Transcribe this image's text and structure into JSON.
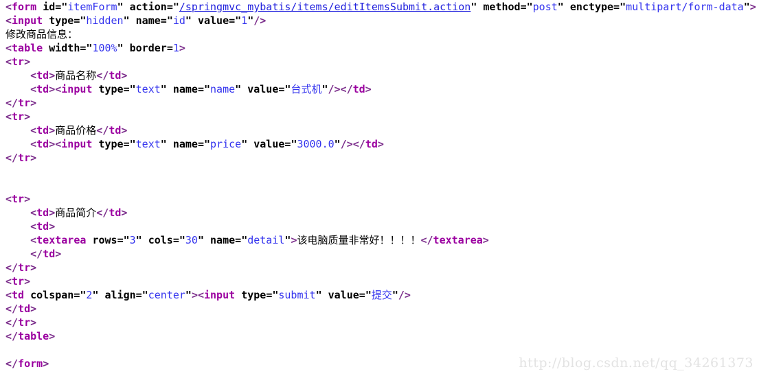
{
  "document": {
    "kind": "html-code-snippet",
    "background_color": "#ffffff",
    "syntax_colors": {
      "tag": "#9b00a0",
      "bracket": "#7b2d8b",
      "attribute": "#000000",
      "value": "#3333ee",
      "link": "#2222dd",
      "text": "#000000",
      "watermark": "#e3e3e3"
    }
  },
  "code": {
    "lines": [
      {
        "id": "line-form-open",
        "indent": 0,
        "tokens": [
          {
            "t": "bracket",
            "v": "<"
          },
          {
            "t": "tag",
            "v": "form"
          },
          {
            "t": "plain",
            "v": " "
          },
          {
            "t": "attr",
            "v": "id"
          },
          {
            "t": "eq",
            "v": "="
          },
          {
            "t": "quote",
            "v": "\""
          },
          {
            "t": "value",
            "v": "itemForm"
          },
          {
            "t": "quote",
            "v": "\""
          },
          {
            "t": "plain",
            "v": " "
          },
          {
            "t": "attr",
            "v": "action"
          },
          {
            "t": "eq",
            "v": "="
          },
          {
            "t": "quote",
            "v": "\""
          },
          {
            "t": "link",
            "v": "/springmvc_mybatis/items/editItemsSubmit.action"
          },
          {
            "t": "quote",
            "v": "\""
          },
          {
            "t": "plain",
            "v": " "
          },
          {
            "t": "attr",
            "v": "method"
          },
          {
            "t": "eq",
            "v": "="
          },
          {
            "t": "quote",
            "v": "\""
          },
          {
            "t": "value",
            "v": "post"
          },
          {
            "t": "quote",
            "v": "\""
          },
          {
            "t": "plain",
            "v": " "
          },
          {
            "t": "attr",
            "v": "enctype"
          },
          {
            "t": "eq",
            "v": "="
          },
          {
            "t": "quote",
            "v": "\""
          },
          {
            "t": "value",
            "v": "multipart/form-data"
          },
          {
            "t": "quote",
            "v": "\""
          },
          {
            "t": "bracket",
            "v": ">"
          }
        ]
      },
      {
        "id": "line-input-hidden",
        "indent": 0,
        "tokens": [
          {
            "t": "bracket",
            "v": "<"
          },
          {
            "t": "tag",
            "v": "input"
          },
          {
            "t": "plain",
            "v": " "
          },
          {
            "t": "attr",
            "v": "type"
          },
          {
            "t": "eq",
            "v": "="
          },
          {
            "t": "quote",
            "v": "\""
          },
          {
            "t": "value",
            "v": "hidden"
          },
          {
            "t": "quote",
            "v": "\""
          },
          {
            "t": "plain",
            "v": " "
          },
          {
            "t": "attr",
            "v": "name"
          },
          {
            "t": "eq",
            "v": "="
          },
          {
            "t": "quote",
            "v": "\""
          },
          {
            "t": "value",
            "v": "id"
          },
          {
            "t": "quote",
            "v": "\""
          },
          {
            "t": "plain",
            "v": " "
          },
          {
            "t": "attr",
            "v": "value"
          },
          {
            "t": "eq",
            "v": "="
          },
          {
            "t": "quote",
            "v": "\""
          },
          {
            "t": "value",
            "v": "1"
          },
          {
            "t": "quote",
            "v": "\""
          },
          {
            "t": "bracket",
            "v": "/>"
          }
        ]
      },
      {
        "id": "line-title-text",
        "indent": 0,
        "tokens": [
          {
            "t": "cjk",
            "v": "修改商品信息："
          }
        ]
      },
      {
        "id": "line-table-open",
        "indent": 0,
        "tokens": [
          {
            "t": "bracket",
            "v": "<"
          },
          {
            "t": "tag",
            "v": "table"
          },
          {
            "t": "plain",
            "v": " "
          },
          {
            "t": "attr",
            "v": "width"
          },
          {
            "t": "eq",
            "v": "="
          },
          {
            "t": "quote",
            "v": "\""
          },
          {
            "t": "value",
            "v": "100%"
          },
          {
            "t": "quote",
            "v": "\""
          },
          {
            "t": "plain",
            "v": " "
          },
          {
            "t": "attr",
            "v": "border"
          },
          {
            "t": "eq",
            "v": "="
          },
          {
            "t": "value",
            "v": "1"
          },
          {
            "t": "bracket",
            "v": ">"
          }
        ]
      },
      {
        "id": "line-tr-open-1",
        "indent": 0,
        "tokens": [
          {
            "t": "bracket",
            "v": "<"
          },
          {
            "t": "tag",
            "v": "tr"
          },
          {
            "t": "bracket",
            "v": ">"
          }
        ]
      },
      {
        "id": "line-td-name-label",
        "indent": 4,
        "tokens": [
          {
            "t": "bracket",
            "v": "<"
          },
          {
            "t": "tag",
            "v": "td"
          },
          {
            "t": "bracket",
            "v": ">"
          },
          {
            "t": "cjk",
            "v": "商品名称"
          },
          {
            "t": "bracket",
            "v": "</"
          },
          {
            "t": "tag",
            "v": "td"
          },
          {
            "t": "bracket",
            "v": ">"
          }
        ]
      },
      {
        "id": "line-td-name-input",
        "indent": 4,
        "tokens": [
          {
            "t": "bracket",
            "v": "<"
          },
          {
            "t": "tag",
            "v": "td"
          },
          {
            "t": "bracket",
            "v": "><"
          },
          {
            "t": "tag",
            "v": "input"
          },
          {
            "t": "plain",
            "v": " "
          },
          {
            "t": "attr",
            "v": "type"
          },
          {
            "t": "eq",
            "v": "="
          },
          {
            "t": "quote",
            "v": "\""
          },
          {
            "t": "value",
            "v": "text"
          },
          {
            "t": "quote",
            "v": "\""
          },
          {
            "t": "plain",
            "v": " "
          },
          {
            "t": "attr",
            "v": "name"
          },
          {
            "t": "eq",
            "v": "="
          },
          {
            "t": "quote",
            "v": "\""
          },
          {
            "t": "value",
            "v": "name"
          },
          {
            "t": "quote",
            "v": "\""
          },
          {
            "t": "plain",
            "v": " "
          },
          {
            "t": "attr",
            "v": "value"
          },
          {
            "t": "eq",
            "v": "="
          },
          {
            "t": "quote",
            "v": "\""
          },
          {
            "t": "value-cjk",
            "v": "台式机"
          },
          {
            "t": "quote",
            "v": "\""
          },
          {
            "t": "bracket",
            "v": "/></"
          },
          {
            "t": "tag",
            "v": "td"
          },
          {
            "t": "bracket",
            "v": ">"
          }
        ]
      },
      {
        "id": "line-tr-close-1",
        "indent": 0,
        "tokens": [
          {
            "t": "bracket",
            "v": "</"
          },
          {
            "t": "tag",
            "v": "tr"
          },
          {
            "t": "bracket",
            "v": ">"
          }
        ]
      },
      {
        "id": "line-tr-open-2",
        "indent": 0,
        "tokens": [
          {
            "t": "bracket",
            "v": "<"
          },
          {
            "t": "tag",
            "v": "tr"
          },
          {
            "t": "bracket",
            "v": ">"
          }
        ]
      },
      {
        "id": "line-td-price-label",
        "indent": 4,
        "tokens": [
          {
            "t": "bracket",
            "v": "<"
          },
          {
            "t": "tag",
            "v": "td"
          },
          {
            "t": "bracket",
            "v": ">"
          },
          {
            "t": "cjk",
            "v": "商品价格"
          },
          {
            "t": "bracket",
            "v": "</"
          },
          {
            "t": "tag",
            "v": "td"
          },
          {
            "t": "bracket",
            "v": ">"
          }
        ]
      },
      {
        "id": "line-td-price-input",
        "indent": 4,
        "tokens": [
          {
            "t": "bracket",
            "v": "<"
          },
          {
            "t": "tag",
            "v": "td"
          },
          {
            "t": "bracket",
            "v": "><"
          },
          {
            "t": "tag",
            "v": "input"
          },
          {
            "t": "plain",
            "v": " "
          },
          {
            "t": "attr",
            "v": "type"
          },
          {
            "t": "eq",
            "v": "="
          },
          {
            "t": "quote",
            "v": "\""
          },
          {
            "t": "value",
            "v": "text"
          },
          {
            "t": "quote",
            "v": "\""
          },
          {
            "t": "plain",
            "v": " "
          },
          {
            "t": "attr",
            "v": "name"
          },
          {
            "t": "eq",
            "v": "="
          },
          {
            "t": "quote",
            "v": "\""
          },
          {
            "t": "value",
            "v": "price"
          },
          {
            "t": "quote",
            "v": "\""
          },
          {
            "t": "plain",
            "v": " "
          },
          {
            "t": "attr",
            "v": "value"
          },
          {
            "t": "eq",
            "v": "="
          },
          {
            "t": "quote",
            "v": "\""
          },
          {
            "t": "value",
            "v": "3000.0"
          },
          {
            "t": "quote",
            "v": "\""
          },
          {
            "t": "bracket",
            "v": "/></"
          },
          {
            "t": "tag",
            "v": "td"
          },
          {
            "t": "bracket",
            "v": ">"
          }
        ]
      },
      {
        "id": "line-tr-close-2",
        "indent": 0,
        "tokens": [
          {
            "t": "bracket",
            "v": "</"
          },
          {
            "t": "tag",
            "v": "tr"
          },
          {
            "t": "bracket",
            "v": ">"
          }
        ]
      },
      {
        "id": "line-blank-1",
        "indent": 0,
        "tokens": []
      },
      {
        "id": "line-blank-2",
        "indent": 0,
        "tokens": []
      },
      {
        "id": "line-tr-open-3",
        "indent": 0,
        "tokens": [
          {
            "t": "bracket",
            "v": "<"
          },
          {
            "t": "tag",
            "v": "tr"
          },
          {
            "t": "bracket",
            "v": ">"
          }
        ]
      },
      {
        "id": "line-td-detail-label",
        "indent": 4,
        "tokens": [
          {
            "t": "bracket",
            "v": "<"
          },
          {
            "t": "tag",
            "v": "td"
          },
          {
            "t": "bracket",
            "v": ">"
          },
          {
            "t": "cjk",
            "v": "商品简介"
          },
          {
            "t": "bracket",
            "v": "</"
          },
          {
            "t": "tag",
            "v": "td"
          },
          {
            "t": "bracket",
            "v": ">"
          }
        ]
      },
      {
        "id": "line-td-detail-open",
        "indent": 4,
        "tokens": [
          {
            "t": "bracket",
            "v": "<"
          },
          {
            "t": "tag",
            "v": "td"
          },
          {
            "t": "bracket",
            "v": ">"
          }
        ]
      },
      {
        "id": "line-textarea",
        "indent": 4,
        "tokens": [
          {
            "t": "bracket",
            "v": "<"
          },
          {
            "t": "tag",
            "v": "textarea"
          },
          {
            "t": "plain",
            "v": " "
          },
          {
            "t": "attr",
            "v": "rows"
          },
          {
            "t": "eq",
            "v": "="
          },
          {
            "t": "quote",
            "v": "\""
          },
          {
            "t": "value",
            "v": "3"
          },
          {
            "t": "quote",
            "v": "\""
          },
          {
            "t": "plain",
            "v": " "
          },
          {
            "t": "attr",
            "v": "cols"
          },
          {
            "t": "eq",
            "v": "="
          },
          {
            "t": "quote",
            "v": "\""
          },
          {
            "t": "value",
            "v": "30"
          },
          {
            "t": "quote",
            "v": "\""
          },
          {
            "t": "plain",
            "v": " "
          },
          {
            "t": "attr",
            "v": "name"
          },
          {
            "t": "eq",
            "v": "="
          },
          {
            "t": "quote",
            "v": "\""
          },
          {
            "t": "value",
            "v": "detail"
          },
          {
            "t": "quote",
            "v": "\""
          },
          {
            "t": "bracket",
            "v": ">"
          },
          {
            "t": "cjk",
            "v": "该电脑质量非常好！！！！"
          },
          {
            "t": "bracket",
            "v": "</"
          },
          {
            "t": "tag",
            "v": "textarea"
          },
          {
            "t": "bracket",
            "v": ">"
          }
        ]
      },
      {
        "id": "line-td-detail-close",
        "indent": 4,
        "tokens": [
          {
            "t": "bracket",
            "v": "</"
          },
          {
            "t": "tag",
            "v": "td"
          },
          {
            "t": "bracket",
            "v": ">"
          }
        ]
      },
      {
        "id": "line-tr-close-3",
        "indent": 0,
        "tokens": [
          {
            "t": "bracket",
            "v": "</"
          },
          {
            "t": "tag",
            "v": "tr"
          },
          {
            "t": "bracket",
            "v": ">"
          }
        ]
      },
      {
        "id": "line-tr-open-4",
        "indent": 0,
        "tokens": [
          {
            "t": "bracket",
            "v": "<"
          },
          {
            "t": "tag",
            "v": "tr"
          },
          {
            "t": "bracket",
            "v": ">"
          }
        ]
      },
      {
        "id": "line-td-submit",
        "indent": 0,
        "tokens": [
          {
            "t": "bracket",
            "v": "<"
          },
          {
            "t": "tag",
            "v": "td"
          },
          {
            "t": "plain",
            "v": " "
          },
          {
            "t": "attr",
            "v": "colspan"
          },
          {
            "t": "eq",
            "v": "="
          },
          {
            "t": "quote",
            "v": "\""
          },
          {
            "t": "value",
            "v": "2"
          },
          {
            "t": "quote",
            "v": "\""
          },
          {
            "t": "plain",
            "v": " "
          },
          {
            "t": "attr",
            "v": "align"
          },
          {
            "t": "eq",
            "v": "="
          },
          {
            "t": "quote",
            "v": "\""
          },
          {
            "t": "value",
            "v": "center"
          },
          {
            "t": "quote",
            "v": "\""
          },
          {
            "t": "bracket",
            "v": "><"
          },
          {
            "t": "tag",
            "v": "input"
          },
          {
            "t": "plain",
            "v": " "
          },
          {
            "t": "attr",
            "v": "type"
          },
          {
            "t": "eq",
            "v": "="
          },
          {
            "t": "quote",
            "v": "\""
          },
          {
            "t": "value",
            "v": "submit"
          },
          {
            "t": "quote",
            "v": "\""
          },
          {
            "t": "plain",
            "v": " "
          },
          {
            "t": "attr",
            "v": "value"
          },
          {
            "t": "eq",
            "v": "="
          },
          {
            "t": "quote",
            "v": "\""
          },
          {
            "t": "value-cjk",
            "v": "提交"
          },
          {
            "t": "quote",
            "v": "\""
          },
          {
            "t": "bracket",
            "v": "/>"
          }
        ]
      },
      {
        "id": "line-td-close-submit",
        "indent": 0,
        "tokens": [
          {
            "t": "bracket",
            "v": "</"
          },
          {
            "t": "tag",
            "v": "td"
          },
          {
            "t": "bracket",
            "v": ">"
          }
        ]
      },
      {
        "id": "line-tr-close-4",
        "indent": 0,
        "tokens": [
          {
            "t": "bracket",
            "v": "</"
          },
          {
            "t": "tag",
            "v": "tr"
          },
          {
            "t": "bracket",
            "v": ">"
          }
        ]
      },
      {
        "id": "line-table-close",
        "indent": 0,
        "tokens": [
          {
            "t": "bracket",
            "v": "</"
          },
          {
            "t": "tag",
            "v": "table"
          },
          {
            "t": "bracket",
            "v": ">"
          }
        ]
      },
      {
        "id": "line-blank-3",
        "indent": 0,
        "tokens": []
      },
      {
        "id": "line-form-close",
        "indent": 0,
        "tokens": [
          {
            "t": "bracket",
            "v": "</"
          },
          {
            "t": "tag",
            "v": "form"
          },
          {
            "t": "bracket",
            "v": ">"
          }
        ]
      }
    ]
  },
  "watermark": {
    "text": "http://blog.csdn.net/qq_34261373"
  }
}
